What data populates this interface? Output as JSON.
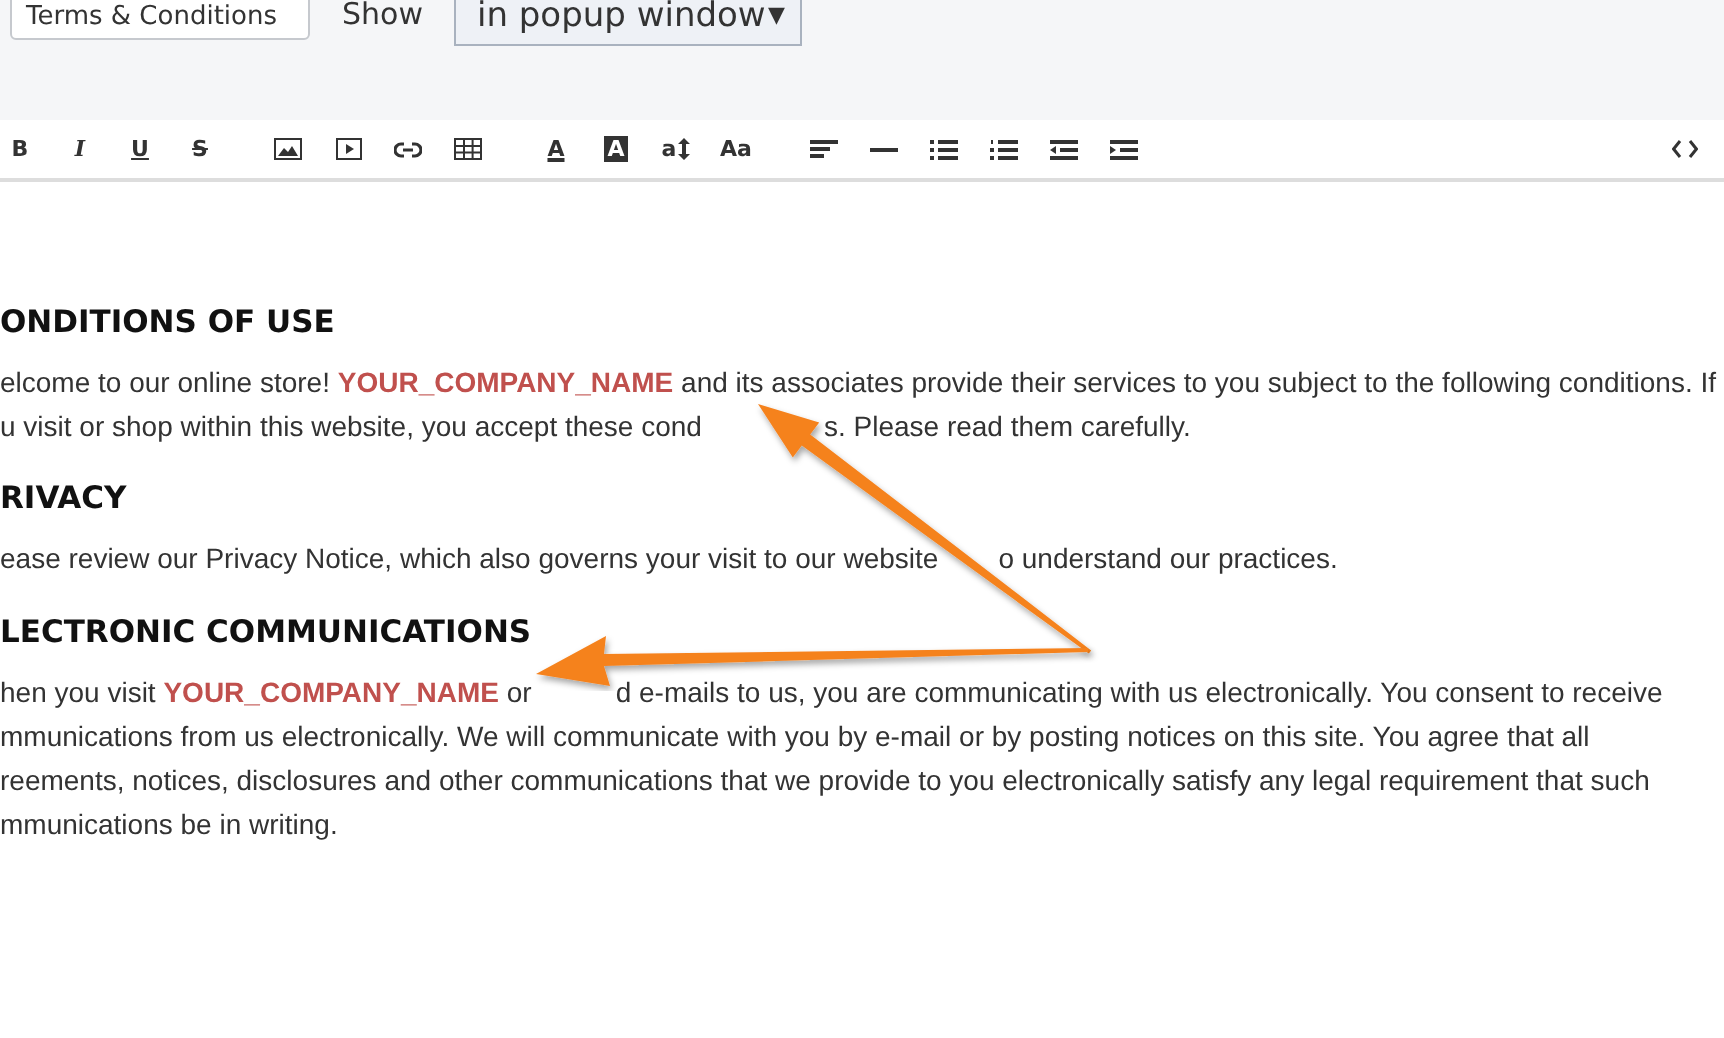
{
  "settings": {
    "title_field": {
      "value": "Terms & Conditions"
    },
    "show_label": "Show",
    "show_select": {
      "value": "in popup window",
      "arrow": "▼"
    }
  },
  "toolbar": {
    "groups": [
      [
        {
          "kind": "bold",
          "label": "B"
        },
        {
          "kind": "italic",
          "label": "I"
        },
        {
          "kind": "underline",
          "label": "U"
        },
        {
          "kind": "strike",
          "label": "S"
        }
      ],
      [
        {
          "kind": "image"
        },
        {
          "kind": "video"
        },
        {
          "kind": "link"
        },
        {
          "kind": "table"
        }
      ],
      [
        {
          "kind": "color",
          "label": "A"
        },
        {
          "kind": "highlight",
          "label": "A"
        },
        {
          "kind": "lineheight",
          "label": "a"
        },
        {
          "kind": "fontsize",
          "label": "Aa"
        }
      ],
      [
        {
          "kind": "align"
        },
        {
          "kind": "rule"
        },
        {
          "kind": "bullets"
        },
        {
          "kind": "numbers"
        },
        {
          "kind": "outdent"
        },
        {
          "kind": "indent"
        }
      ],
      [
        {
          "kind": "code"
        }
      ]
    ]
  },
  "document": [
    {
      "heading": "ONDITIONS OF USE",
      "lines": [
        {
          "segments": [
            "elcome to our online store! **YOUR_COMPANY_NAME** and its associates provide their services to you subject to the following conditions. If"
          ]
        },
        {
          "segments": [
            "u visit or shop within this website, you accept these cond",
            "s. Please read them carefully."
          ]
        }
      ]
    },
    {
      "heading": "RIVACY",
      "lines": [
        {
          "segments": [
            "ease review our Privacy Notice, which also governs your visit to our website",
            "o understand our practices."
          ]
        }
      ]
    },
    {
      "heading": "LECTRONIC COMMUNICATIONS",
      "lines": [
        {
          "segments": [
            "hen you visit **YOUR_COMPANY_NAME** or",
            "d e-mails to us, you are communicating with us electronically. You consent to receive"
          ]
        },
        {
          "segments": [
            "mmunications from us electronically. We will communicate with you by e-mail or by posting notices on this site. You agree that all"
          ]
        },
        {
          "segments": [
            "reements, notices, disclosures and other communications that we provide to you electronically satisfy any legal requirement that such"
          ]
        },
        {
          "segments": [
            "mmunications be in writing."
          ]
        }
      ]
    }
  ]
}
